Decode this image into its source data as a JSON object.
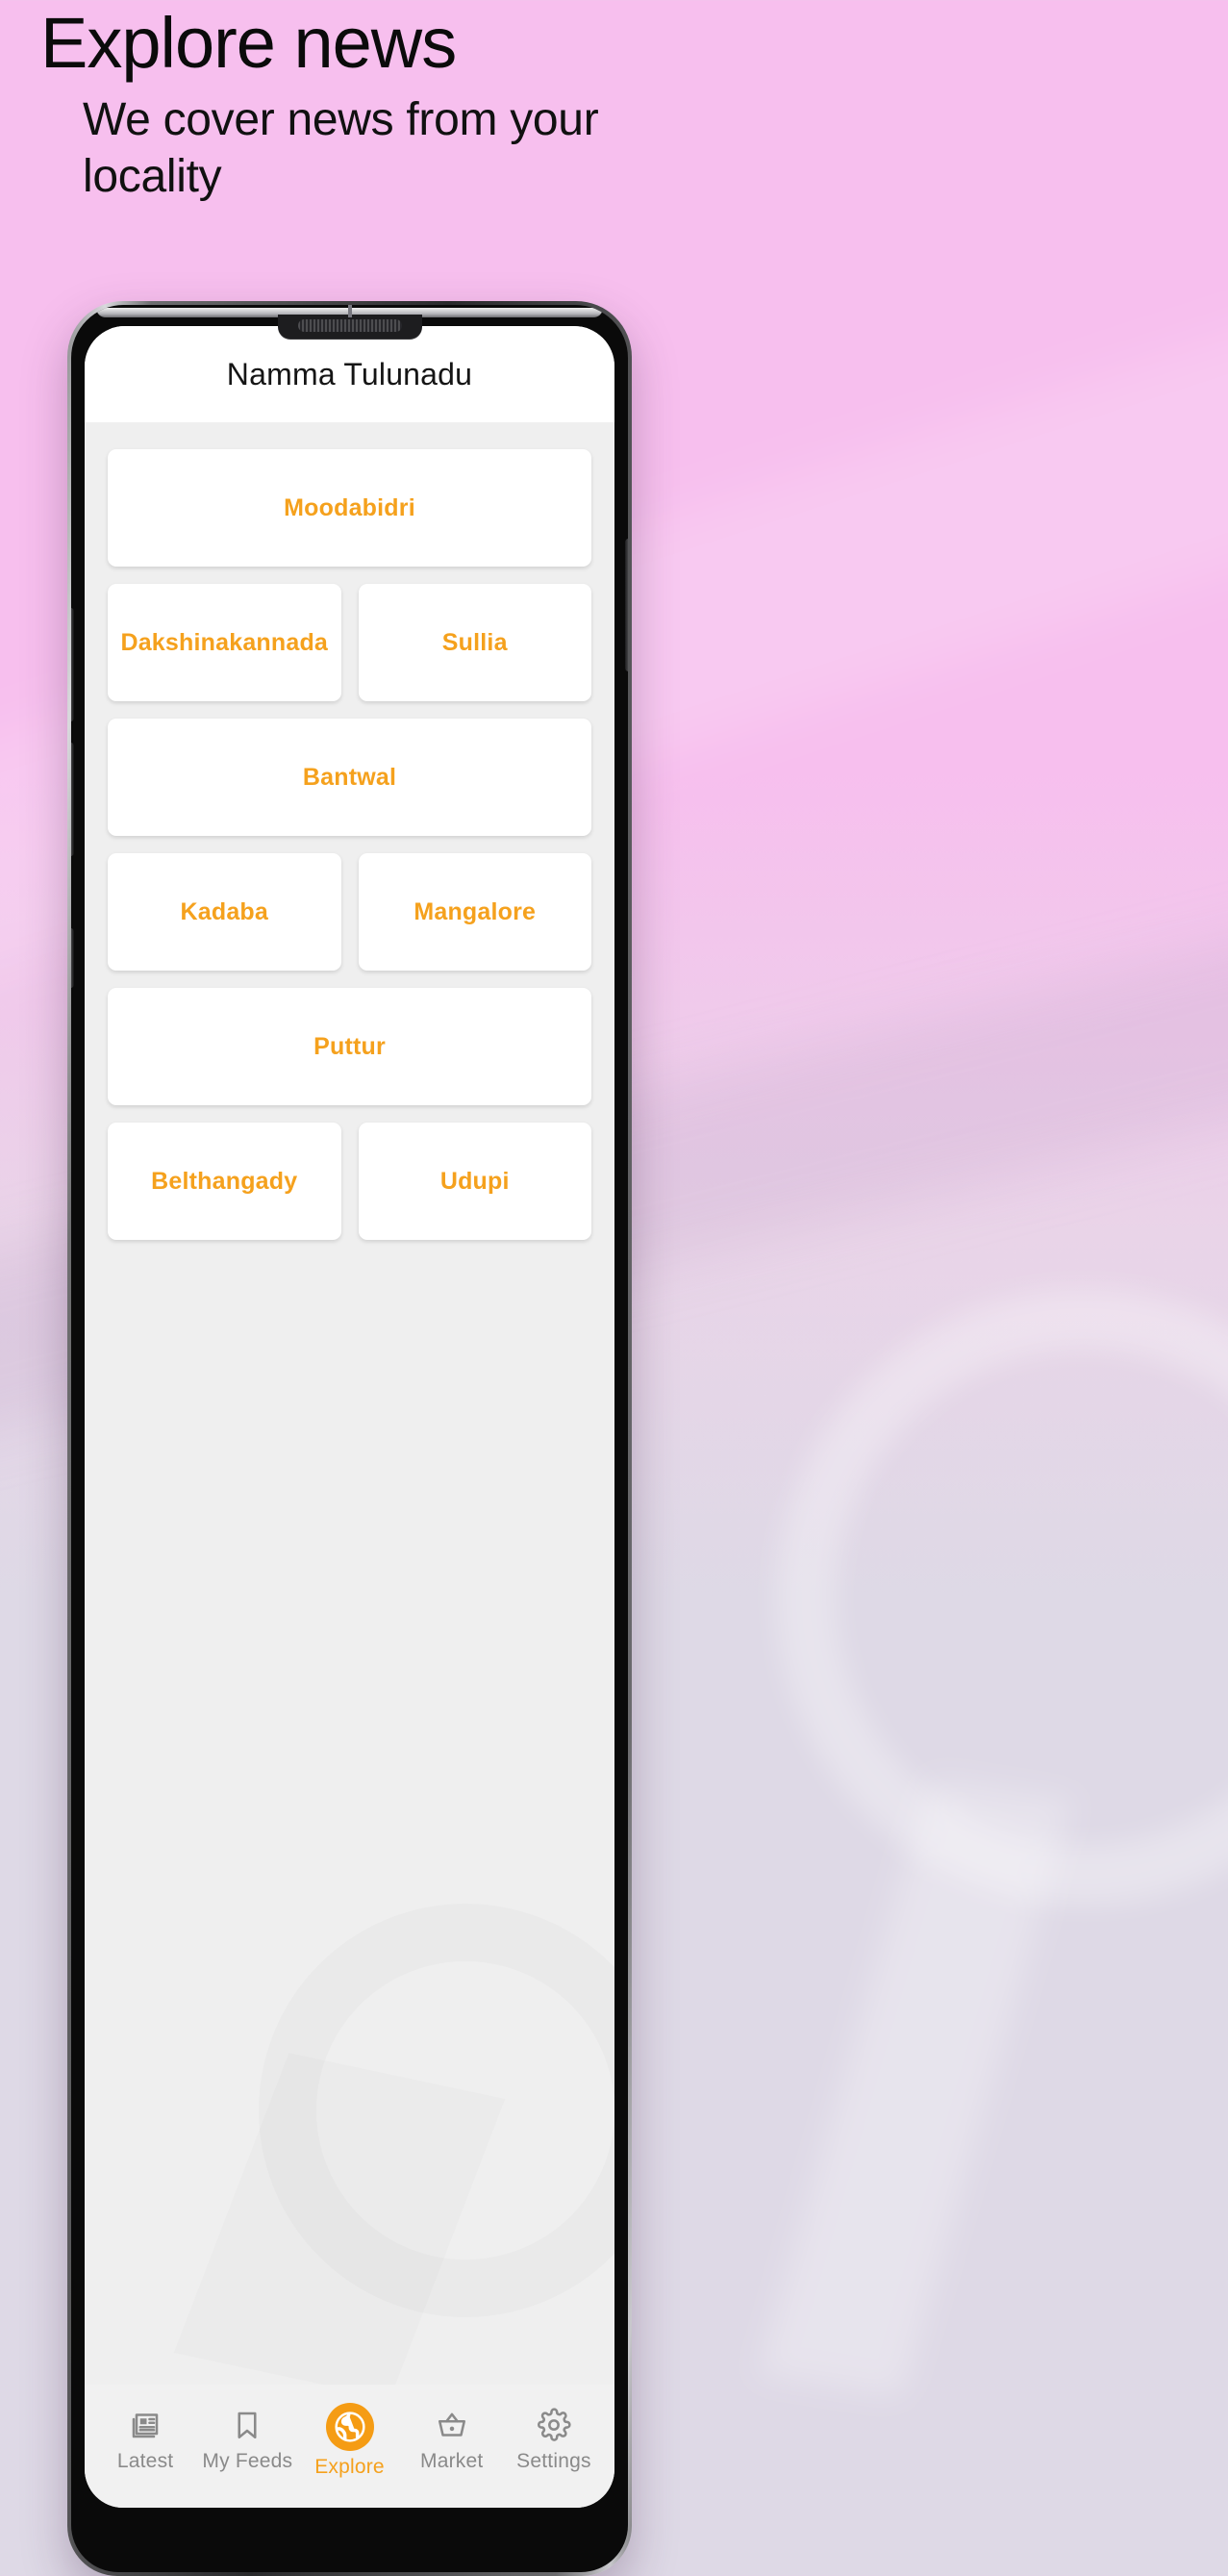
{
  "page": {
    "headline": "Explore news",
    "subheadline": "We cover news from your locality",
    "background_top_color": "#f7bfee",
    "background_bottom_color": "#ded9e6"
  },
  "app": {
    "title": "Namma Tulunadu",
    "accent_color": "#f5a11d",
    "screen_background": "#efefef",
    "appbar_background": "#ffffff"
  },
  "explore": {
    "rows": [
      {
        "cards": [
          {
            "label": "Moodabidri"
          }
        ]
      },
      {
        "cards": [
          {
            "label": "Dakshinakannada"
          },
          {
            "label": "Sullia"
          }
        ]
      },
      {
        "cards": [
          {
            "label": "Bantwal"
          }
        ]
      },
      {
        "cards": [
          {
            "label": "Kadaba"
          },
          {
            "label": "Mangalore"
          }
        ]
      },
      {
        "cards": [
          {
            "label": "Puttur"
          }
        ]
      },
      {
        "cards": [
          {
            "label": "Belthangady"
          },
          {
            "label": "Udupi"
          }
        ]
      }
    ]
  },
  "bottom_nav": {
    "items": [
      {
        "label": "Latest",
        "icon": "newspaper-icon",
        "active": false
      },
      {
        "label": "My Feeds",
        "icon": "bookmark-icon",
        "active": false
      },
      {
        "label": "Explore",
        "icon": "globe-icon",
        "active": true
      },
      {
        "label": "Market",
        "icon": "basket-icon",
        "active": false
      },
      {
        "label": "Settings",
        "icon": "gear-icon",
        "active": false
      }
    ]
  }
}
